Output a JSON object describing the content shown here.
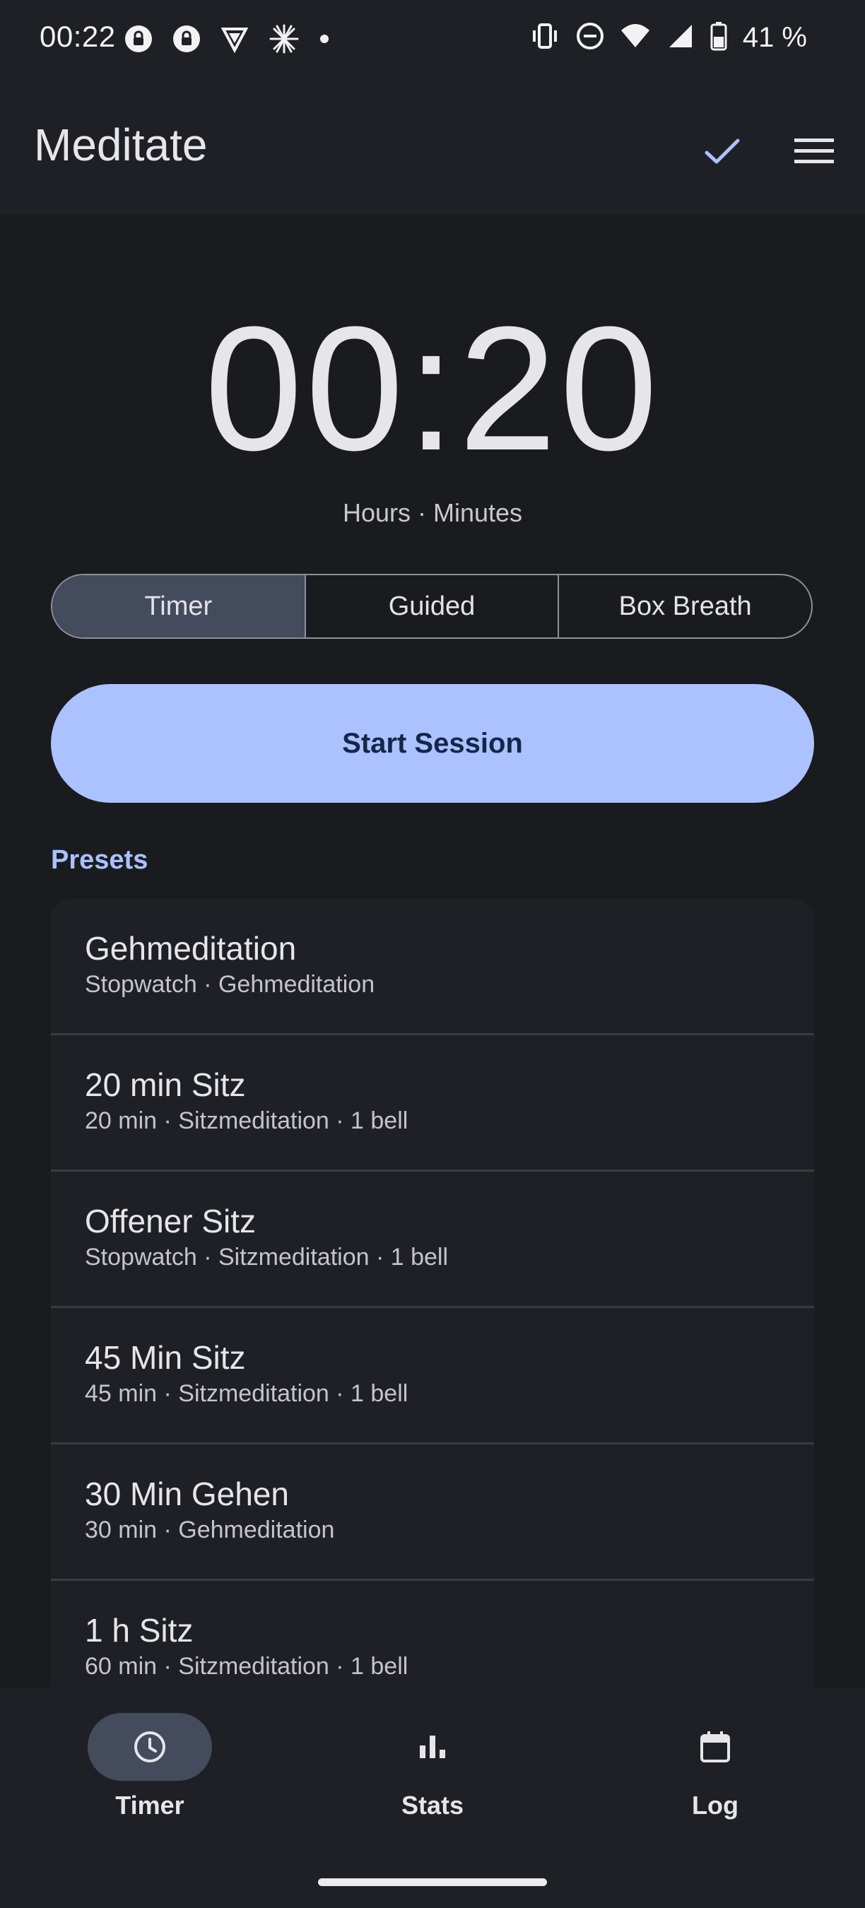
{
  "status_bar": {
    "time": "00:22",
    "battery": "41 %"
  },
  "app_bar": {
    "title": "Meditate"
  },
  "timer": {
    "display": "00:20",
    "units_label": "Hours · Minutes"
  },
  "modes": {
    "items": [
      "Timer",
      "Guided",
      "Box Breath"
    ],
    "selected": "Timer"
  },
  "start_button": {
    "label": "Start Session"
  },
  "presets": {
    "heading": "Presets",
    "items": [
      {
        "title": "Gehmeditation",
        "subtitle": "Stopwatch · Gehmeditation"
      },
      {
        "title": "20 min Sitz",
        "subtitle": "20 min · Sitzmeditation · 1 bell"
      },
      {
        "title": "Offener Sitz",
        "subtitle": "Stopwatch · Sitzmeditation · 1 bell"
      },
      {
        "title": "45 Min Sitz",
        "subtitle": "45 min · Sitzmeditation · 1 bell"
      },
      {
        "title": "30 Min Gehen",
        "subtitle": "30 min · Gehmeditation"
      },
      {
        "title": "1 h Sitz",
        "subtitle": "60 min · Sitzmeditation · 1 bell"
      }
    ]
  },
  "bottom_nav": {
    "items": [
      {
        "label": "Timer",
        "icon": "clock-icon",
        "active": true
      },
      {
        "label": "Stats",
        "icon": "bar-chart-icon",
        "active": false
      },
      {
        "label": "Log",
        "icon": "calendar-icon",
        "active": false
      }
    ]
  },
  "colors": {
    "background": "#1a1b1e",
    "surface": "#1f2026",
    "accent": "#abc2ff",
    "accent_text": "#14274a",
    "active_pill": "#444b5c"
  }
}
